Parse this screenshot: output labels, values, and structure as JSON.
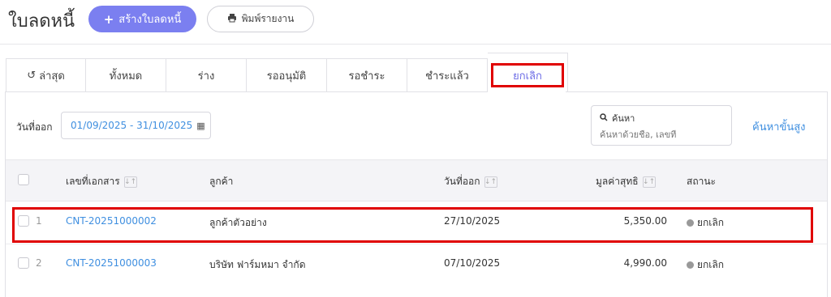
{
  "header": {
    "title": "ใบลดหนี้",
    "create_label": "สร้างใบลดหนี้",
    "create_icon": "plus-icon",
    "print_label": "พิมพ์รายงาน",
    "print_icon": "printer-icon",
    "accent_color": "#7b7ff0"
  },
  "tabs": [
    {
      "label": "ล่าสุด",
      "icon": "history-icon"
    },
    {
      "label": "ทั้งหมด"
    },
    {
      "label": "ร่าง"
    },
    {
      "label": "รออนุมัติ"
    },
    {
      "label": "รอชำระ"
    },
    {
      "label": "ชำระแล้ว"
    },
    {
      "label": "ยกเลิก",
      "active": true
    }
  ],
  "filter": {
    "date_label": "วันที่ออก",
    "date_range": "01/09/2025 - 31/10/2025",
    "search_label": "ค้นหา",
    "search_placeholder": "ค้นหาด้วยชื่อ, เลขที่",
    "advanced_label": "ค้นหาขั้นสูง"
  },
  "table": {
    "columns": {
      "doc_no": "เลขที่เอกสาร",
      "customer": "ลูกค้า",
      "issue_date": "วันที่ออก",
      "net_amount": "มูลค่าสุทธิ",
      "status": "สถานะ"
    },
    "rows": [
      {
        "index": "1",
        "doc_no": "CNT-20251000002",
        "customer": "ลูกค้าตัวอย่าง",
        "issue_date": "27/10/2025",
        "net_amount": "5,350.00",
        "status": "ยกเลิก"
      },
      {
        "index": "2",
        "doc_no": "CNT-20251000003",
        "customer": "บริษัท ฟาร์มหมา จำกัด",
        "issue_date": "07/10/2025",
        "net_amount": "4,990.00",
        "status": "ยกเลิก"
      }
    ]
  },
  "highlight_color": "#e00000"
}
